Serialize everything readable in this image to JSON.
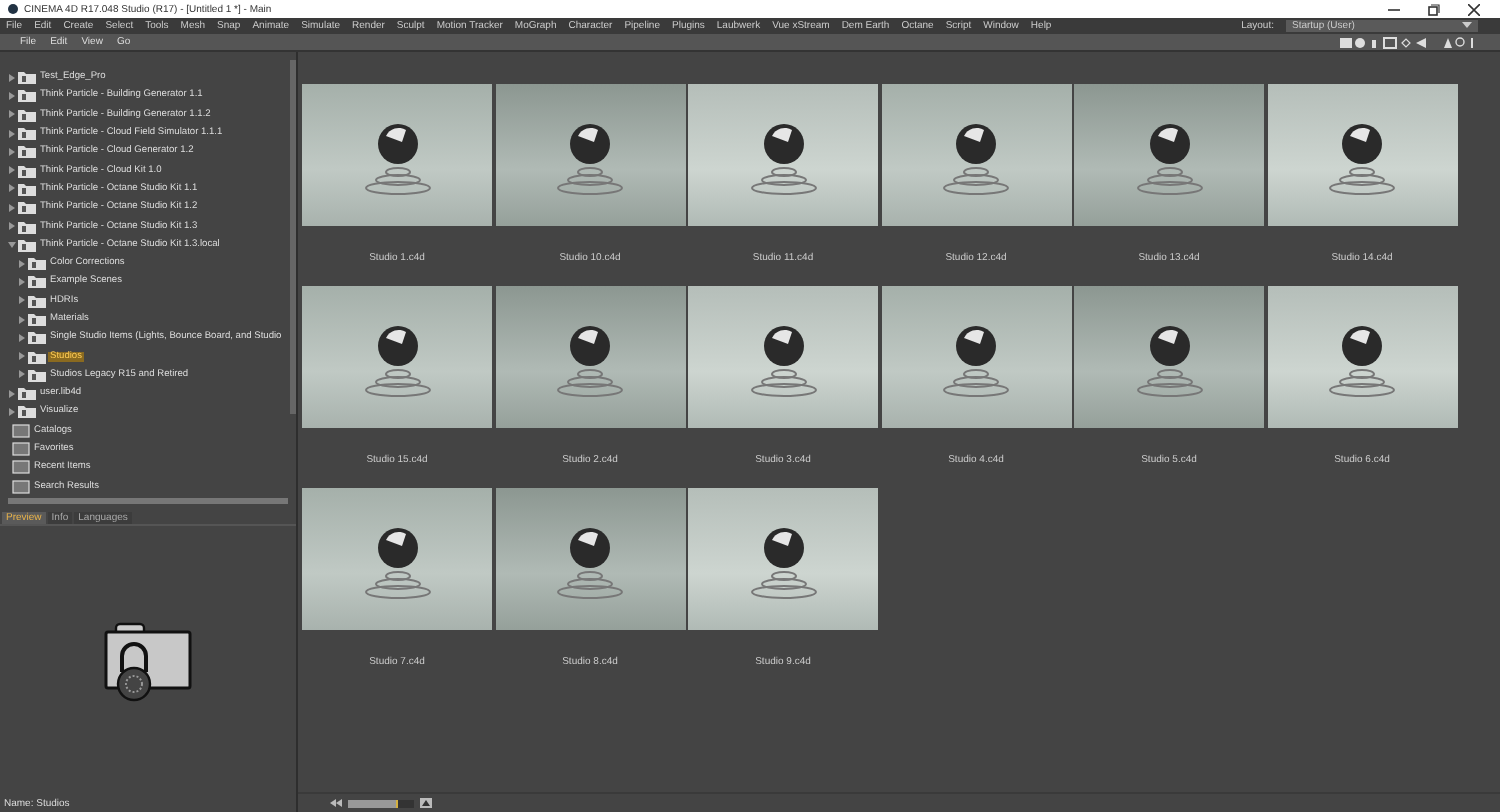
{
  "window": {
    "title": "CINEMA 4D R17.048 Studio (R17) - [Untitled 1 *] - Main"
  },
  "menu_bar": [
    "File",
    "Edit",
    "Create",
    "Select",
    "Tools",
    "Mesh",
    "Snap",
    "Animate",
    "Simulate",
    "Render",
    "Sculpt",
    "Motion Tracker",
    "MoGraph",
    "Character",
    "Pipeline",
    "Plugins",
    "Laubwerk",
    "Vue xStream",
    "Dem Earth",
    "Octane",
    "Script",
    "Window",
    "Help"
  ],
  "layout": {
    "label": "Layout:",
    "value": "Startup (User)"
  },
  "browser_menu": [
    "File",
    "Edit",
    "View",
    "Go"
  ],
  "tree": [
    {
      "label": "Test_Edge_Pro",
      "expanded": false,
      "selected": false
    },
    {
      "label": "Think Particle - Building Generator 1.1",
      "expanded": false,
      "selected": false
    },
    {
      "label": "Think Particle - Building Generator 1.1.2",
      "expanded": false,
      "selected": false
    },
    {
      "label": "Think Particle - Cloud Field Simulator 1.1.1",
      "expanded": false,
      "selected": false
    },
    {
      "label": "Think Particle - Cloud Generator 1.2",
      "expanded": false,
      "selected": false
    },
    {
      "label": "Think Particle - Cloud Kit 1.0",
      "expanded": false,
      "selected": false
    },
    {
      "label": "Think Particle - Octane Studio Kit 1.1",
      "expanded": false,
      "selected": false
    },
    {
      "label": "Think Particle - Octane Studio Kit 1.2",
      "expanded": false,
      "selected": false
    },
    {
      "label": "Think Particle - Octane Studio Kit 1.3",
      "expanded": false,
      "selected": false
    },
    {
      "label": "Think Particle - Octane Studio Kit 1.3.local",
      "expanded": true,
      "selected": false,
      "children": [
        {
          "label": "Color Corrections",
          "expanded": false,
          "selected": false
        },
        {
          "label": "Example Scenes",
          "expanded": false,
          "selected": false
        },
        {
          "label": "HDRIs",
          "expanded": false,
          "selected": false
        },
        {
          "label": "Materials",
          "expanded": false,
          "selected": false
        },
        {
          "label": "Single Studio Items (Lights, Bounce Board, and Studio",
          "expanded": false,
          "selected": false
        },
        {
          "label": "Studios",
          "expanded": false,
          "selected": true
        },
        {
          "label": "Studios Legacy R15 and Retired",
          "expanded": false,
          "selected": false
        }
      ]
    },
    {
      "label": "user.lib4d",
      "expanded": false,
      "selected": false
    },
    {
      "label": "Visualize",
      "expanded": false,
      "selected": false
    }
  ],
  "sections": [
    "Catalogs",
    "Favorites",
    "Recent Items",
    "Search Results"
  ],
  "tabs": [
    {
      "label": "Preview",
      "selected": true
    },
    {
      "label": "Info",
      "selected": false
    },
    {
      "label": "Languages",
      "selected": false
    }
  ],
  "preview": {
    "name_label": "Name:",
    "name": "Studios"
  },
  "files": [
    "Studio 1.c4d",
    "Studio 10.c4d",
    "Studio 11.c4d",
    "Studio 12.c4d",
    "Studio 13.c4d",
    "Studio 14.c4d",
    "Studio 15.c4d",
    "Studio 2.c4d",
    "Studio 3.c4d",
    "Studio 4.c4d",
    "Studio 5.c4d",
    "Studio 6.c4d",
    "Studio 7.c4d",
    "Studio 8.c4d",
    "Studio 9.c4d"
  ],
  "zoom_slider": {
    "level": 0.75
  }
}
